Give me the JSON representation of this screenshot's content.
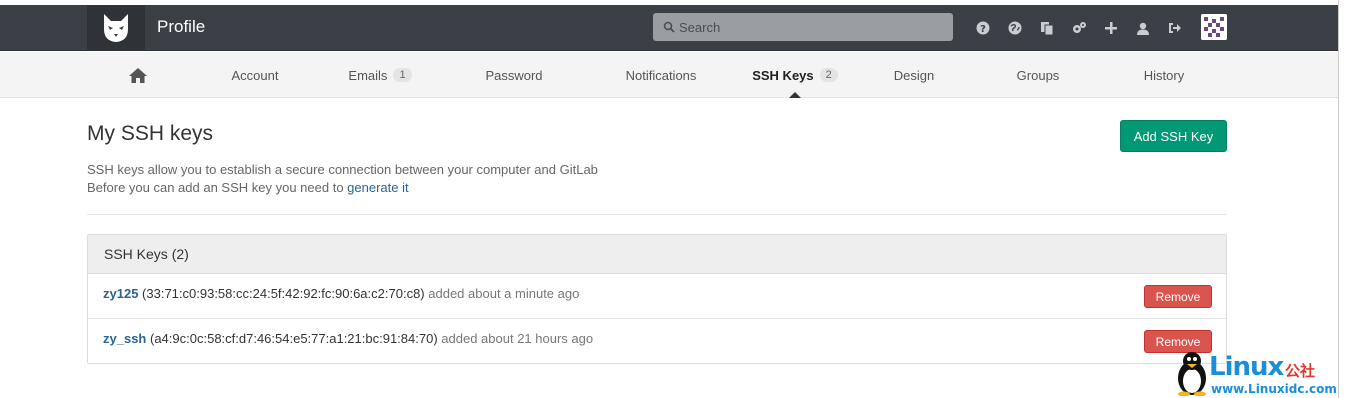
{
  "header": {
    "title": "Profile",
    "search_placeholder": "Search",
    "icons": [
      "help-icon",
      "globe-icon",
      "copy-icon",
      "cogs-icon",
      "plus-icon",
      "user-icon",
      "logout-icon"
    ]
  },
  "subnav": {
    "items": [
      {
        "label": "",
        "icon": "home-icon"
      },
      {
        "label": "Account"
      },
      {
        "label": "Emails",
        "badge": "1"
      },
      {
        "label": "Password"
      },
      {
        "label": "Notifications"
      },
      {
        "label": "SSH Keys",
        "badge": "2"
      },
      {
        "label": "Design"
      },
      {
        "label": "Groups"
      },
      {
        "label": "History"
      }
    ],
    "active": "SSH Keys"
  },
  "page": {
    "title": "My SSH keys",
    "add_button": "Add SSH Key",
    "desc_line1": "SSH keys allow you to establish a secure connection between your computer and GitLab",
    "desc_line2_prefix": "Before you can add an SSH key you need to ",
    "desc_link": "generate it"
  },
  "panel": {
    "heading": "SSH Keys (2)",
    "keys": [
      {
        "name": "zy125",
        "fingerprint": "(33:71:c0:93:58:cc:24:5f:42:92:fc:90:6a:c2:70:c8)",
        "added": "added about a minute ago",
        "remove_label": "Remove"
      },
      {
        "name": "zy_ssh",
        "fingerprint": "(a4:9c:0c:58:cf:d7:46:54:e5:77:a1:21:bc:91:84:70)",
        "added": "added about 21 hours ago",
        "remove_label": "Remove"
      }
    ]
  },
  "watermark": {
    "brand": "Linux",
    "cn": "公社",
    "url": "www.Linuxidc.com"
  },
  "colors": {
    "navbar": "#3b4046",
    "success": "#019875",
    "danger": "#d9534f",
    "link": "#2a6496"
  }
}
